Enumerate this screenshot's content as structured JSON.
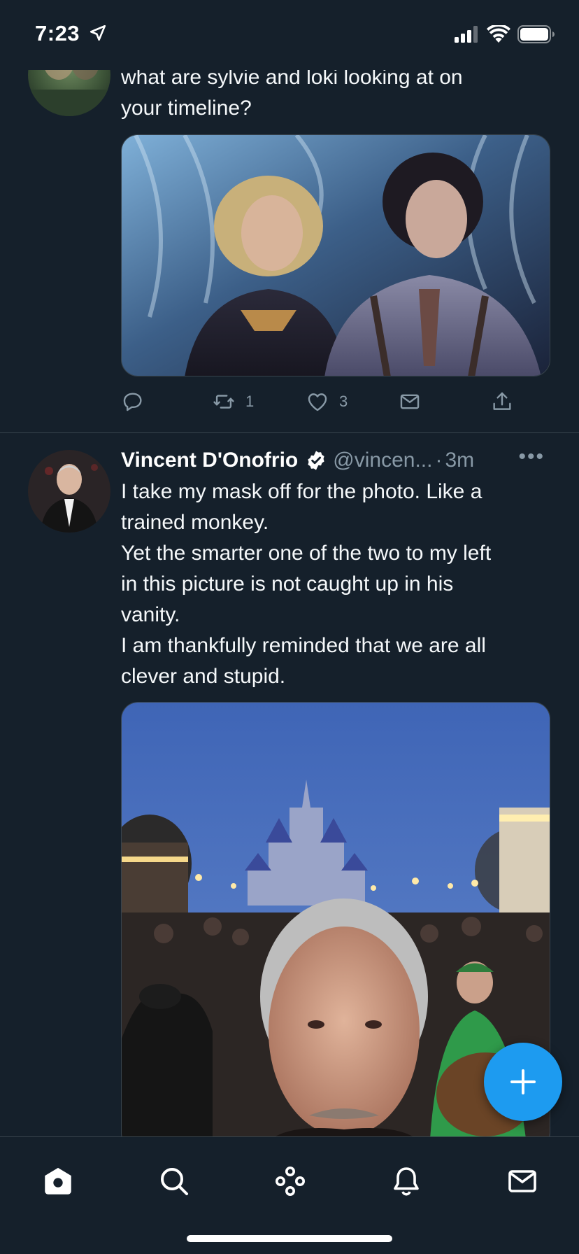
{
  "status_bar": {
    "time": "7:23"
  },
  "tweets": [
    {
      "text_lines": [
        "what are sylvie and loki looking at on",
        "your timeline?"
      ],
      "image_icon": "photo-sylvie-loki",
      "actions": {
        "reply_count": "",
        "retweet_count": "1",
        "like_count": "3"
      }
    },
    {
      "author": {
        "name": "Vincent D'Onofrio",
        "handle": "@vincen...",
        "separator": "·",
        "time": "3m",
        "more": "•••"
      },
      "text_lines": [
        "I take my mask off for the photo. Like a",
        "trained monkey.",
        "Yet the smarter one of the two to my left",
        "in this picture is not caught up in his",
        "vanity.",
        "I am thankfully reminded that we are all",
        "clever and stupid."
      ],
      "image_icon": "photo-castle-selfie"
    }
  ],
  "tab_bar": {
    "items": [
      "home-icon",
      "search-icon",
      "spaces-icon",
      "notifications-icon",
      "messages-icon"
    ]
  },
  "fab": {
    "icon": "compose-plus-icon"
  },
  "colors": {
    "background": "#15202b",
    "accent": "#1d9bf0",
    "muted": "#8899a6",
    "divider": "#38444d"
  }
}
